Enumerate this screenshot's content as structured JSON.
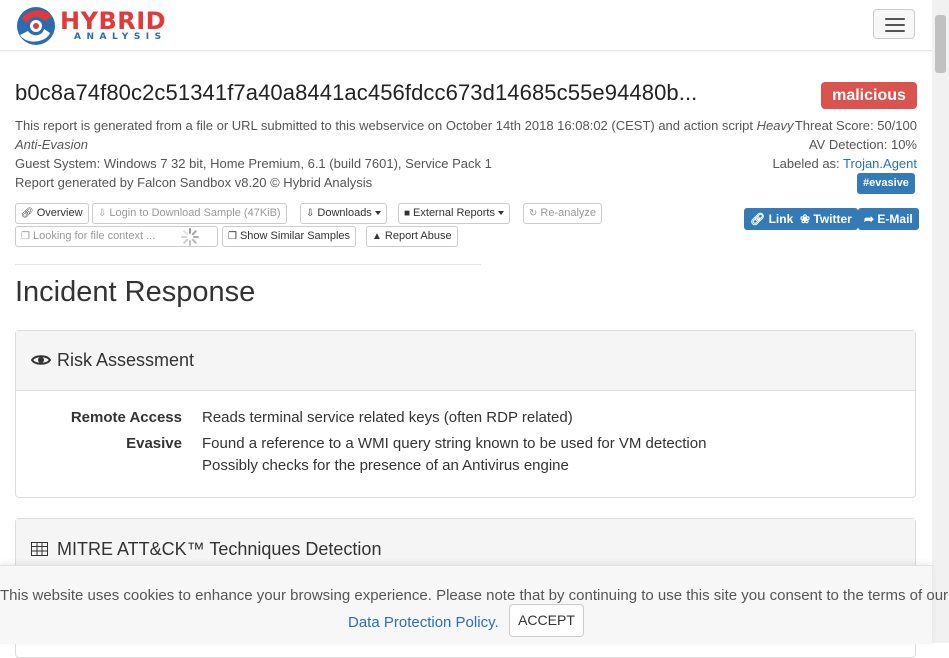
{
  "brand": {
    "name": "HYBRID",
    "sub": "ANALYSIS"
  },
  "report": {
    "hash": "b0c8a74f80c2c51341f7a40a8441ac456fdcc673d14685c55e94480b...",
    "verdict": "malicious",
    "desc_line1": "This report is generated from a file or URL submitted to this webservice on October 14th 2018 16:08:02 (CEST) and action script ",
    "desc_script_a": "Heavy",
    "desc_script_b": "Anti-Evasion",
    "guest": "Guest System: Windows 7 32 bit, Home Premium, 6.1 (build 7601), Service Pack 1",
    "generator": "Report generated by Falcon Sandbox v8.20 © Hybrid Analysis",
    "threat_score": "Threat Score: 50/100",
    "av_detection": "AV Detection: 10%",
    "labeled_prefix": "Labeled as: ",
    "labeled_value": "Trojan.Agent",
    "tag": "#evasive"
  },
  "actions": {
    "overview": "Overview",
    "login_download": "Login to Download Sample (47KiB)",
    "downloads": "Downloads",
    "external_reports": "External Reports",
    "reanalyze": "Re-analyze",
    "file_context": "Looking for file context ...",
    "similar": "Show Similar Samples",
    "report_abuse": "Report Abuse"
  },
  "share": {
    "link": "Link",
    "twitter": "Twitter",
    "email": "E-Mail"
  },
  "incident": {
    "title": "Incident Response",
    "risk_title": "Risk Assessment",
    "rows": [
      {
        "label": "Remote Access",
        "items": [
          "Reads terminal service related keys (often RDP related)"
        ]
      },
      {
        "label": "Evasive",
        "items": [
          "Found a reference to a WMI query string known to be used for VM detection",
          "Possibly checks for the presence of an Antivirus engine"
        ]
      }
    ],
    "mitre_title": "MITRE ATT&CK™ Techniques Detection"
  },
  "cookie": {
    "text": "This website uses cookies to enhance your browsing experience. Please note that by continuing to use this site you consent to the terms of our",
    "link": "Data Protection Policy.",
    "accept": "ACCEPT"
  },
  "colors": {
    "brand_red": "#e23a3a",
    "brand_blue": "#2b6cb0",
    "danger": "#d9534f",
    "primary": "#337ab7",
    "link": "#2a6ebb",
    "twitter": "#1da1f2"
  }
}
